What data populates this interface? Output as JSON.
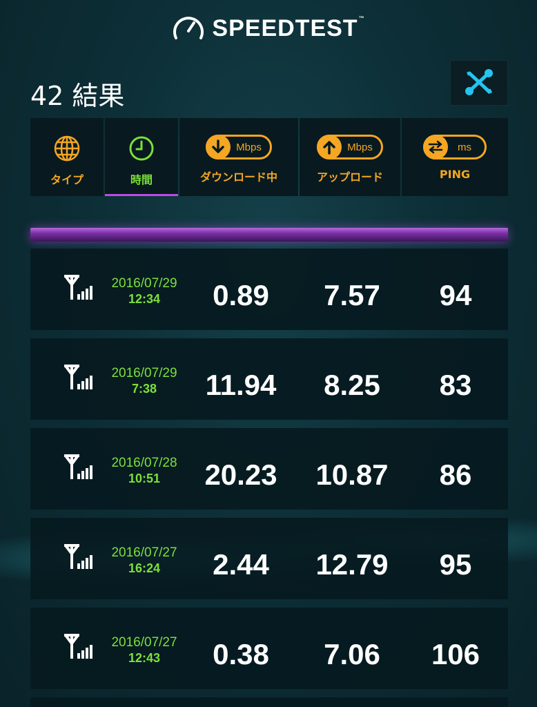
{
  "app": {
    "logo_text": "SPEEDTEST",
    "trademark": "™"
  },
  "results": {
    "title": "42 結果"
  },
  "tabs": [
    {
      "label": "タイプ",
      "icon": "globe-icon",
      "active": false
    },
    {
      "label": "時間",
      "icon": "clock-icon",
      "active": true
    },
    {
      "label": "ダウンロード中",
      "icon": "download-arrow-icon",
      "unit": "Mbps",
      "active": false
    },
    {
      "label": "アップロード",
      "icon": "upload-arrow-icon",
      "unit": "Mbps",
      "active": false
    },
    {
      "label": "PING",
      "icon": "ping-arrows-icon",
      "unit": "ms",
      "active": false
    }
  ],
  "rows": [
    {
      "connection_icon": "cellular-signal-icon",
      "date": "2016/07/29",
      "time": "12:34",
      "download": "0.89",
      "upload": "7.57",
      "ping": "94"
    },
    {
      "connection_icon": "cellular-signal-icon",
      "date": "2016/07/29",
      "time": "7:38",
      "download": "11.94",
      "upload": "8.25",
      "ping": "83"
    },
    {
      "connection_icon": "cellular-signal-icon",
      "date": "2016/07/28",
      "time": "10:51",
      "download": "20.23",
      "upload": "10.87",
      "ping": "86"
    },
    {
      "connection_icon": "cellular-signal-icon",
      "date": "2016/07/27",
      "time": "16:24",
      "download": "2.44",
      "upload": "12.79",
      "ping": "95"
    },
    {
      "connection_icon": "cellular-signal-icon",
      "date": "2016/07/27",
      "time": "12:43",
      "download": "0.38",
      "upload": "7.06",
      "ping": "106"
    }
  ],
  "colors": {
    "accent_orange": "#f5a623",
    "accent_green": "#7de03a",
    "accent_purple": "#c04ae8",
    "settings_icon": "#27c3f0"
  }
}
